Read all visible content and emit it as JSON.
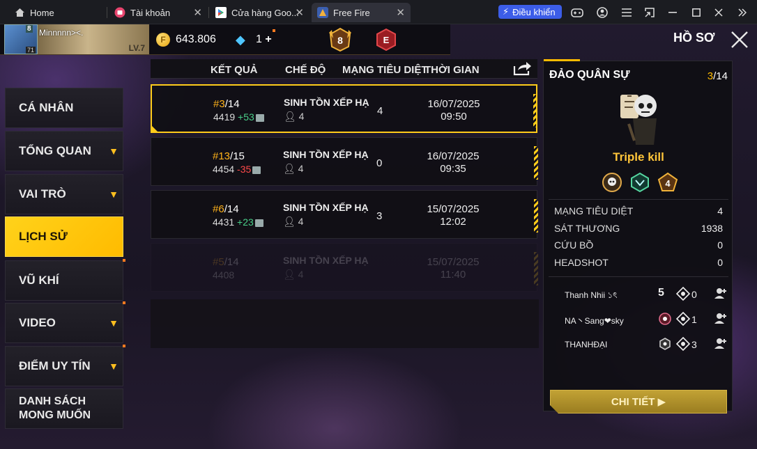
{
  "browser": {
    "tabs": [
      {
        "label": "Home",
        "icon": "home-icon"
      },
      {
        "label": "Tài khoản",
        "icon": "account-app-icon"
      },
      {
        "label": "Cửa hàng Goo...",
        "icon": "play-store-icon"
      },
      {
        "label": "Free Fire",
        "icon": "free-fire-icon"
      }
    ],
    "control_button": "Điều khiển"
  },
  "header": {
    "player_name": "Minnnnn><.",
    "avatar_badge": "8",
    "avatar_level": "71",
    "banner_level": "LV.7",
    "gold": "643.806",
    "diamonds": "1",
    "diamond_plus": "+",
    "rank_number": "8",
    "rank2_letter": "E",
    "page_title": "HỒ SƠ"
  },
  "sidebar": [
    {
      "label": "CÁ NHÂN",
      "chevron": false,
      "active": false,
      "dot": false
    },
    {
      "label": "TỔNG QUAN",
      "chevron": true,
      "active": false,
      "dot": false
    },
    {
      "label": "VAI TRÒ",
      "chevron": true,
      "active": false,
      "dot": false
    },
    {
      "label": "LỊCH SỬ",
      "chevron": false,
      "active": true,
      "dot": false
    },
    {
      "label": "VŨ KHÍ",
      "chevron": false,
      "active": false,
      "dot": true
    },
    {
      "label": "VIDEO",
      "chevron": true,
      "active": false,
      "dot": true
    },
    {
      "label": "ĐIỂM UY TÍN",
      "chevron": true,
      "active": false,
      "dot": true
    },
    {
      "label_line1": "DANH SÁCH",
      "label_line2": "MONG MUỐN",
      "chevron": false,
      "active": false,
      "dot": false
    }
  ],
  "table": {
    "headers": [
      "KẾT QUẢ",
      "CHẾ ĐỘ",
      "MẠNG TIÊU DIỆT",
      "THỜI GIAN"
    ],
    "rows": [
      {
        "rank": "#3",
        "total": "/14",
        "score": "4419",
        "delta": "+53",
        "mode": "SINH TỒN XẾP HẠ",
        "players": "4",
        "kills": "4",
        "date": "16/07/2025",
        "time": "09:50"
      },
      {
        "rank": "#13",
        "total": "/15",
        "score": "4454",
        "delta": "-35",
        "mode": "SINH TỒN XẾP HẠ",
        "players": "4",
        "kills": "0",
        "date": "16/07/2025",
        "time": "09:35"
      },
      {
        "rank": "#6",
        "total": "/14",
        "score": "4431",
        "delta": "+23",
        "mode": "SINH TỒN XẾP HẠ",
        "players": "4",
        "kills": "3",
        "date": "15/07/2025",
        "time": "12:02"
      },
      {
        "rank": "#5",
        "total": "/14",
        "score": "4408",
        "delta": "",
        "mode": "SINH TỒN XẾP HẠ",
        "players": "4",
        "kills": "",
        "date": "15/07/2025",
        "time": "11:40"
      }
    ]
  },
  "detail": {
    "map": "ĐẢO QUÂN SỰ",
    "position": "3",
    "position_total": "/14",
    "kill_title": "Triple kill",
    "stats": [
      {
        "label": "MẠNG TIÊU DIỆT",
        "value": "4"
      },
      {
        "label": "SÁT THƯƠNG",
        "value": "1938"
      },
      {
        "label": "CỨU BỒ",
        "value": "0"
      },
      {
        "label": "HEADSHOT",
        "value": "0"
      }
    ],
    "teammates": [
      {
        "name": "Thanh Nhii ১ৎ",
        "badge": "5",
        "kills": "0"
      },
      {
        "name": "NA丶Sang❤sky",
        "badge": "",
        "kills": "1"
      },
      {
        "name": "THANHĐẠI",
        "badge": "",
        "kills": "3"
      }
    ],
    "button": "CHI TIẾT ▶"
  },
  "colors": {
    "accent": "#ffbb00",
    "gain": "#4ad08a",
    "loss": "#ff4a4a"
  }
}
